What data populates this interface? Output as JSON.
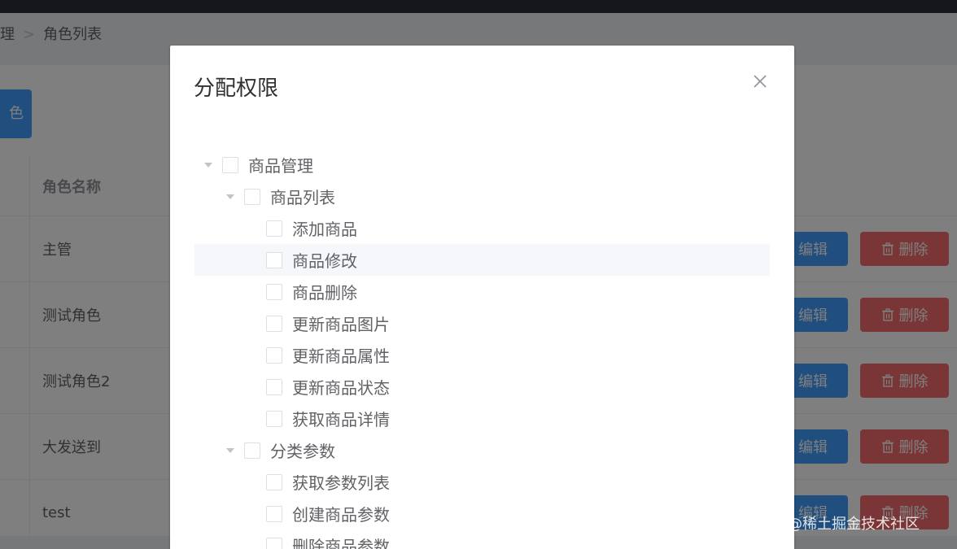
{
  "breadcrumb": {
    "parent_fragment": "理",
    "separator": ">",
    "current": "角色列表"
  },
  "toolbar": {
    "add_label_fragment": "色"
  },
  "table": {
    "header": {
      "name": "角色名称"
    },
    "rows": [
      {
        "name": "主管"
      },
      {
        "name": "测试角色"
      },
      {
        "name": "测试角色2"
      },
      {
        "name": "大发送到"
      },
      {
        "name": "test"
      }
    ],
    "edit_label": "编辑",
    "delete_label": "删除"
  },
  "dialog": {
    "title": "分配权限",
    "tree": [
      {
        "label": "商品管理",
        "level": 0,
        "expanded": true,
        "checked": false
      },
      {
        "label": "商品列表",
        "level": 1,
        "expanded": true,
        "checked": false
      },
      {
        "label": "添加商品",
        "level": 2,
        "checked": false
      },
      {
        "label": "商品修改",
        "level": 2,
        "checked": false,
        "hovered": true
      },
      {
        "label": "商品删除",
        "level": 2,
        "checked": false
      },
      {
        "label": "更新商品图片",
        "level": 2,
        "checked": false
      },
      {
        "label": "更新商品属性",
        "level": 2,
        "checked": false
      },
      {
        "label": "更新商品状态",
        "level": 2,
        "checked": false
      },
      {
        "label": "获取商品详情",
        "level": 2,
        "checked": false
      },
      {
        "label": "分类参数",
        "level": 1,
        "expanded": true,
        "checked": false
      },
      {
        "label": "获取参数列表",
        "level": 2,
        "checked": false
      },
      {
        "label": "创建商品参数",
        "level": 2,
        "checked": false
      },
      {
        "label": "删除商品参数",
        "level": 2,
        "checked": false
      }
    ]
  },
  "watermark": "@稀土掘金技术社区",
  "colors": {
    "primary": "#409eff",
    "danger": "#f56c6c",
    "overlay": "rgba(0,0,0,0.5)"
  }
}
